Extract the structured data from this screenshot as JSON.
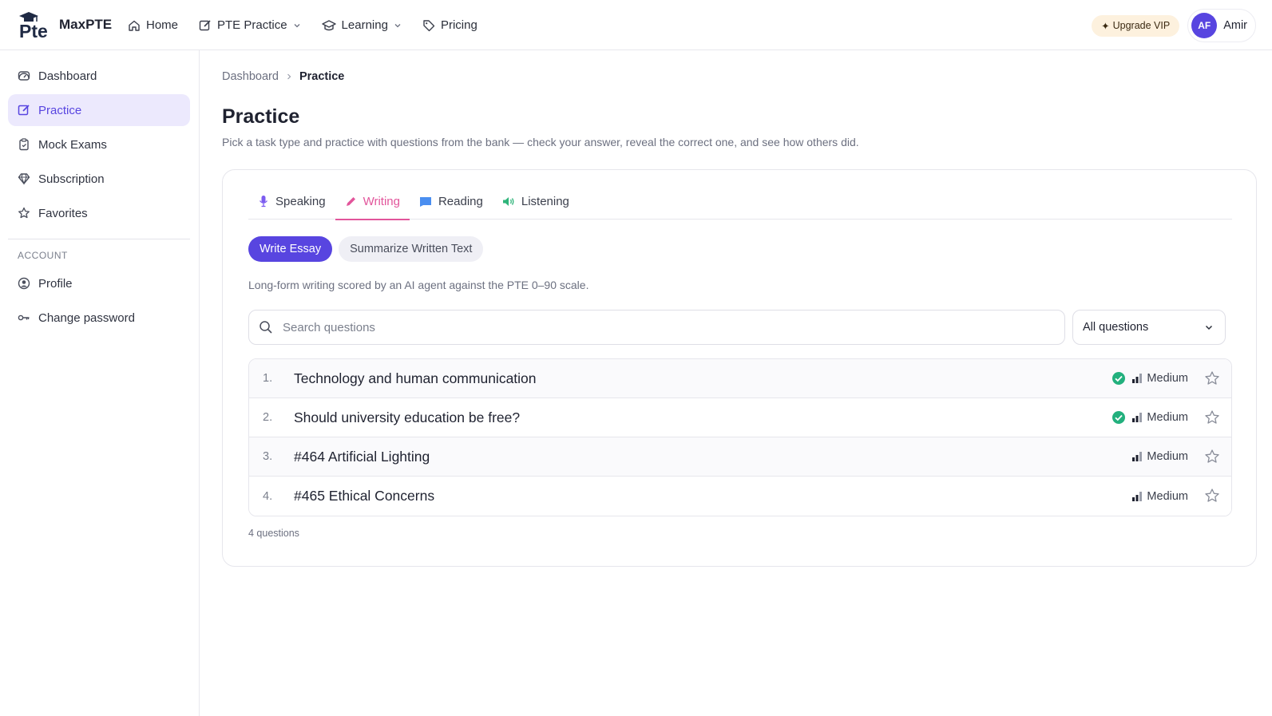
{
  "brand": {
    "name": "MaxPTE",
    "logo_text": "Pte"
  },
  "topnav": [
    {
      "label": "Home",
      "icon": "home-icon"
    },
    {
      "label": "PTE Practice",
      "icon": "edit-icon",
      "dropdown": true
    },
    {
      "label": "Learning",
      "icon": "graduation-cap-icon",
      "dropdown": true
    },
    {
      "label": "Pricing",
      "icon": "tag-icon"
    }
  ],
  "header": {
    "vip_label": "Upgrade VIP",
    "avatar_initials": "AF",
    "user_name": "Amir"
  },
  "sidebar": {
    "items": [
      {
        "label": "Dashboard",
        "icon": "gauge-icon"
      },
      {
        "label": "Practice",
        "icon": "edit-icon",
        "active": true
      },
      {
        "label": "Mock Exams",
        "icon": "clipboard-icon"
      },
      {
        "label": "Subscription",
        "icon": "diamond-icon"
      },
      {
        "label": "Favorites",
        "icon": "star-icon"
      }
    ],
    "account_heading": "ACCOUNT",
    "account_items": [
      {
        "label": "Profile",
        "icon": "user-circle-icon"
      },
      {
        "label": "Change password",
        "icon": "key-icon"
      }
    ]
  },
  "breadcrumb": {
    "parent": "Dashboard",
    "current": "Practice"
  },
  "page": {
    "title": "Practice",
    "subtitle": "Pick a task type and practice with questions from the bank — check your answer, reveal the correct one, and see how others did."
  },
  "tabs": [
    {
      "label": "Speaking",
      "icon": "microphone-icon",
      "color": "#7c5cf0"
    },
    {
      "label": "Writing",
      "icon": "pencil-icon",
      "color": "#e2559b",
      "active": true
    },
    {
      "label": "Reading",
      "icon": "book-icon",
      "color": "#4a8ef0"
    },
    {
      "label": "Listening",
      "icon": "speaker-icon",
      "color": "#2fb47a"
    }
  ],
  "task_types": [
    {
      "label": "Write Essay",
      "active": true
    },
    {
      "label": "Summarize Written Text",
      "active": false
    }
  ],
  "task_description": "Long-form writing scored by an AI agent against the PTE 0–90 scale.",
  "search": {
    "placeholder": "Search questions"
  },
  "filter": {
    "selected": "All questions"
  },
  "questions": [
    {
      "number": "1.",
      "title": "Technology and human communication",
      "difficulty": "Medium",
      "completed": true
    },
    {
      "number": "2.",
      "title": "Should university education be free?",
      "difficulty": "Medium",
      "completed": true
    },
    {
      "number": "3.",
      "title": "#464 Artificial Lighting",
      "difficulty": "Medium",
      "completed": false
    },
    {
      "number": "4.",
      "title": "#465 Ethical Concerns",
      "difficulty": "Medium",
      "completed": false
    }
  ],
  "question_count": "4 questions",
  "colors": {
    "accent": "#5845e0",
    "writing": "#e2559b",
    "success": "#22b07d",
    "vip_bg": "#fdf1de"
  }
}
